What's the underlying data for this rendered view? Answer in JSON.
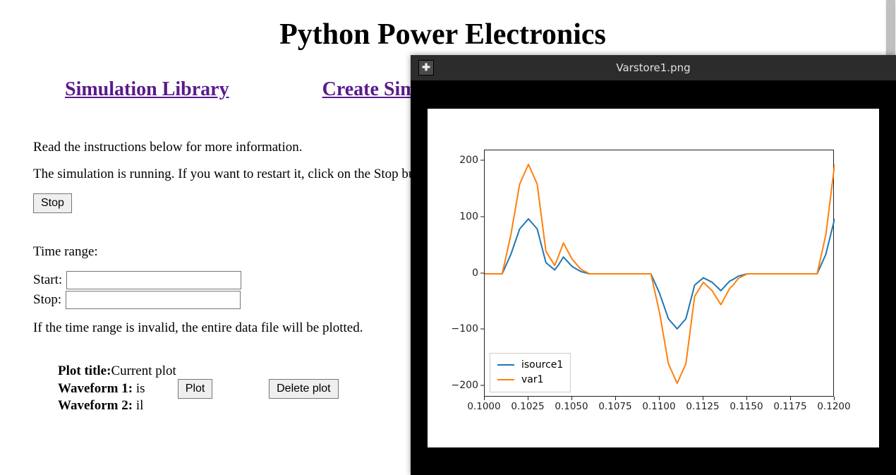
{
  "page_title": "Python Power Electronics",
  "nav": {
    "sim_library": "Simulation Library",
    "create_sim": "Create Simulation"
  },
  "instructions_line": "Read the instructions below for more information.",
  "running_line": "The simulation is running. If you want to restart it, click on the Stop button below, change whatever parameters you need to and click on Run.",
  "stop_label": "Stop",
  "time_range_label": "Time range:",
  "start_label": "Start: ",
  "stop_time_label": "Stop: ",
  "invalid_range_line": "If the time range is invalid, the entire data file will be plotted.",
  "start_value": "",
  "stop_value": "",
  "plot_info": {
    "title_label": "Plot title:",
    "title_value": "Current plot",
    "wf1_label": "Waveform 1: ",
    "wf1_value": "is",
    "wf2_label": "Waveform 2: ",
    "wf2_value": "il"
  },
  "plot_actions": {
    "plot_label": "Plot",
    "delete_label": "Delete plot"
  },
  "viewer": {
    "title": "Varstore1.png"
  },
  "chart_data": {
    "type": "line",
    "xlabel": "",
    "ylabel": "",
    "xlim": [
      0.1,
      0.12
    ],
    "ylim": [
      -220,
      220
    ],
    "x_ticks": [
      0.1,
      0.1025,
      0.105,
      0.1075,
      0.11,
      0.1125,
      0.115,
      0.1175,
      0.12
    ],
    "x_tick_labels": [
      "0.1000",
      "0.1025",
      "0.1050",
      "0.1075",
      "0.1100",
      "0.1125",
      "0.1150",
      "0.1175",
      "0.1200"
    ],
    "y_ticks": [
      -200,
      -100,
      0,
      100,
      200
    ],
    "y_tick_labels": [
      "−200",
      "−100",
      "0",
      "100",
      "200"
    ],
    "colors": {
      "isource1": "#1f77b4",
      "var1": "#ff7f0e"
    },
    "series": [
      {
        "name": "isource1",
        "x": [
          0.1,
          0.101,
          0.1015,
          0.102,
          0.1025,
          0.103,
          0.1035,
          0.104,
          0.1042,
          0.1045,
          0.105,
          0.1055,
          0.106,
          0.109,
          0.1095,
          0.11,
          0.1105,
          0.111,
          0.1115,
          0.112,
          0.1125,
          0.113,
          0.1135,
          0.114,
          0.1142,
          0.1145,
          0.115,
          0.1155,
          0.116,
          0.119,
          0.1195,
          0.12
        ],
        "y": [
          0,
          0,
          35,
          80,
          98,
          80,
          20,
          7,
          15,
          30,
          13,
          4,
          0,
          0,
          0,
          -35,
          -80,
          -98,
          -80,
          -20,
          -7,
          -15,
          -30,
          -13,
          -10,
          -4,
          0,
          0,
          0,
          0,
          35,
          98
        ]
      },
      {
        "name": "var1",
        "x": [
          0.1,
          0.101,
          0.1015,
          0.102,
          0.1025,
          0.103,
          0.1035,
          0.104,
          0.1042,
          0.1045,
          0.105,
          0.1055,
          0.106,
          0.109,
          0.1095,
          0.11,
          0.1105,
          0.111,
          0.1115,
          0.112,
          0.1125,
          0.113,
          0.1135,
          0.114,
          0.1142,
          0.1145,
          0.115,
          0.1155,
          0.116,
          0.119,
          0.1195,
          0.12
        ],
        "y": [
          0,
          0,
          70,
          160,
          195,
          160,
          40,
          15,
          30,
          55,
          26,
          8,
          0,
          0,
          0,
          -70,
          -160,
          -195,
          -160,
          -40,
          -15,
          -30,
          -55,
          -26,
          -20,
          -8,
          0,
          0,
          0,
          0,
          70,
          195
        ]
      }
    ]
  }
}
